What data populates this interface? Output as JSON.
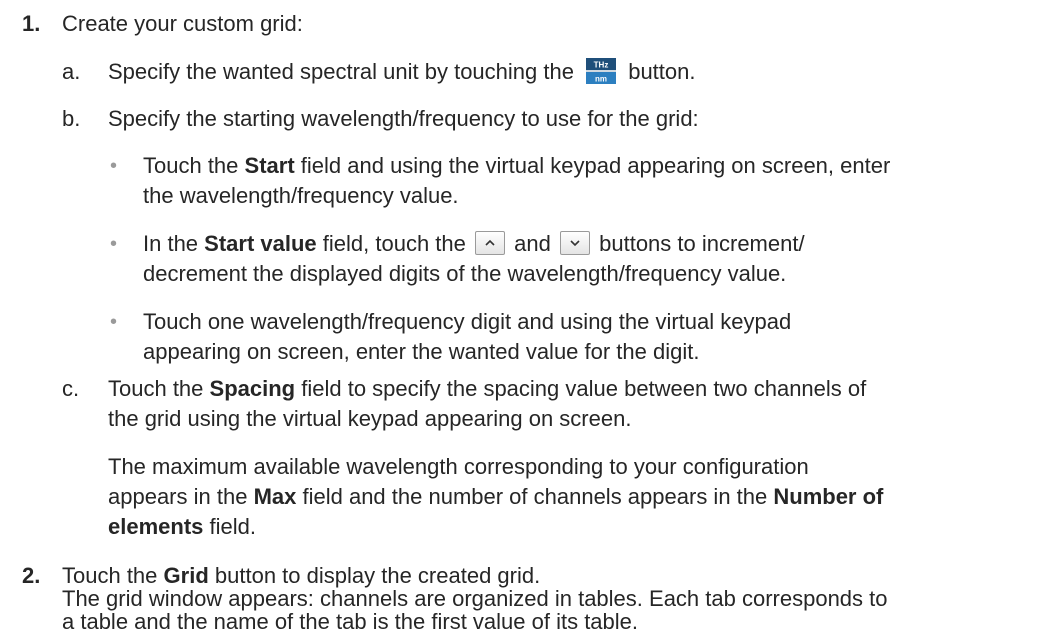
{
  "steps": [
    {
      "number": "1.",
      "text": "Create your custom grid:",
      "substeps": [
        {
          "letter": "a.",
          "before": "Specify the wanted spectral unit by touching the",
          "icon_top": "THz",
          "icon_bottom": "nm",
          "after": "button."
        },
        {
          "letter": "b.",
          "text": "Specify the starting wavelength/frequency to use for the grid:",
          "bullets": [
            {
              "pre": "Touch the",
              "bold": "Start",
              "post": "field and using the virtual keypad appearing on screen, enter",
              "line2": "the wavelength/frequency value."
            },
            {
              "pre": "In the",
              "bold": "Start value",
              "mid1": "field, touch the",
              "up_icon": "chevron-up-icon",
              "mid2": "and",
              "down_icon": "chevron-down-icon",
              "post": "buttons to increment/",
              "line2": "decrement the displayed digits of the wavelength/frequency value."
            },
            {
              "line1": "Touch one wavelength/frequency digit and using the virtual keypad",
              "line2": "appearing on screen, enter the wanted value for the digit."
            }
          ]
        },
        {
          "letter": "c.",
          "pre": "Touch the",
          "bold": "Spacing",
          "post": "field to specify the spacing value between two channels of",
          "line2": "the grid using the virtual keypad appearing on screen.",
          "note": {
            "line1": "The maximum available wavelength corresponding to your configuration",
            "line2_pre": "appears in the",
            "line2_bold1": "Max",
            "line2_mid": "field and the number of channels appears in the",
            "line2_bold2": "Number of",
            "line3_bold": "elements",
            "line3_post": "field."
          }
        }
      ]
    },
    {
      "number": "2.",
      "pre": "Touch the",
      "bold": "Grid",
      "post": "button to display the created grid.",
      "line2": "The grid window appears: channels are organized in tables. Each tab corresponds to",
      "line3": "a table and the name of the tab is the first value of its table."
    }
  ],
  "colors": {
    "text": "#262626",
    "bullet": "#9a9a9a",
    "icon_top": "#1f4f7a",
    "icon_bottom": "#2c7fc0"
  }
}
